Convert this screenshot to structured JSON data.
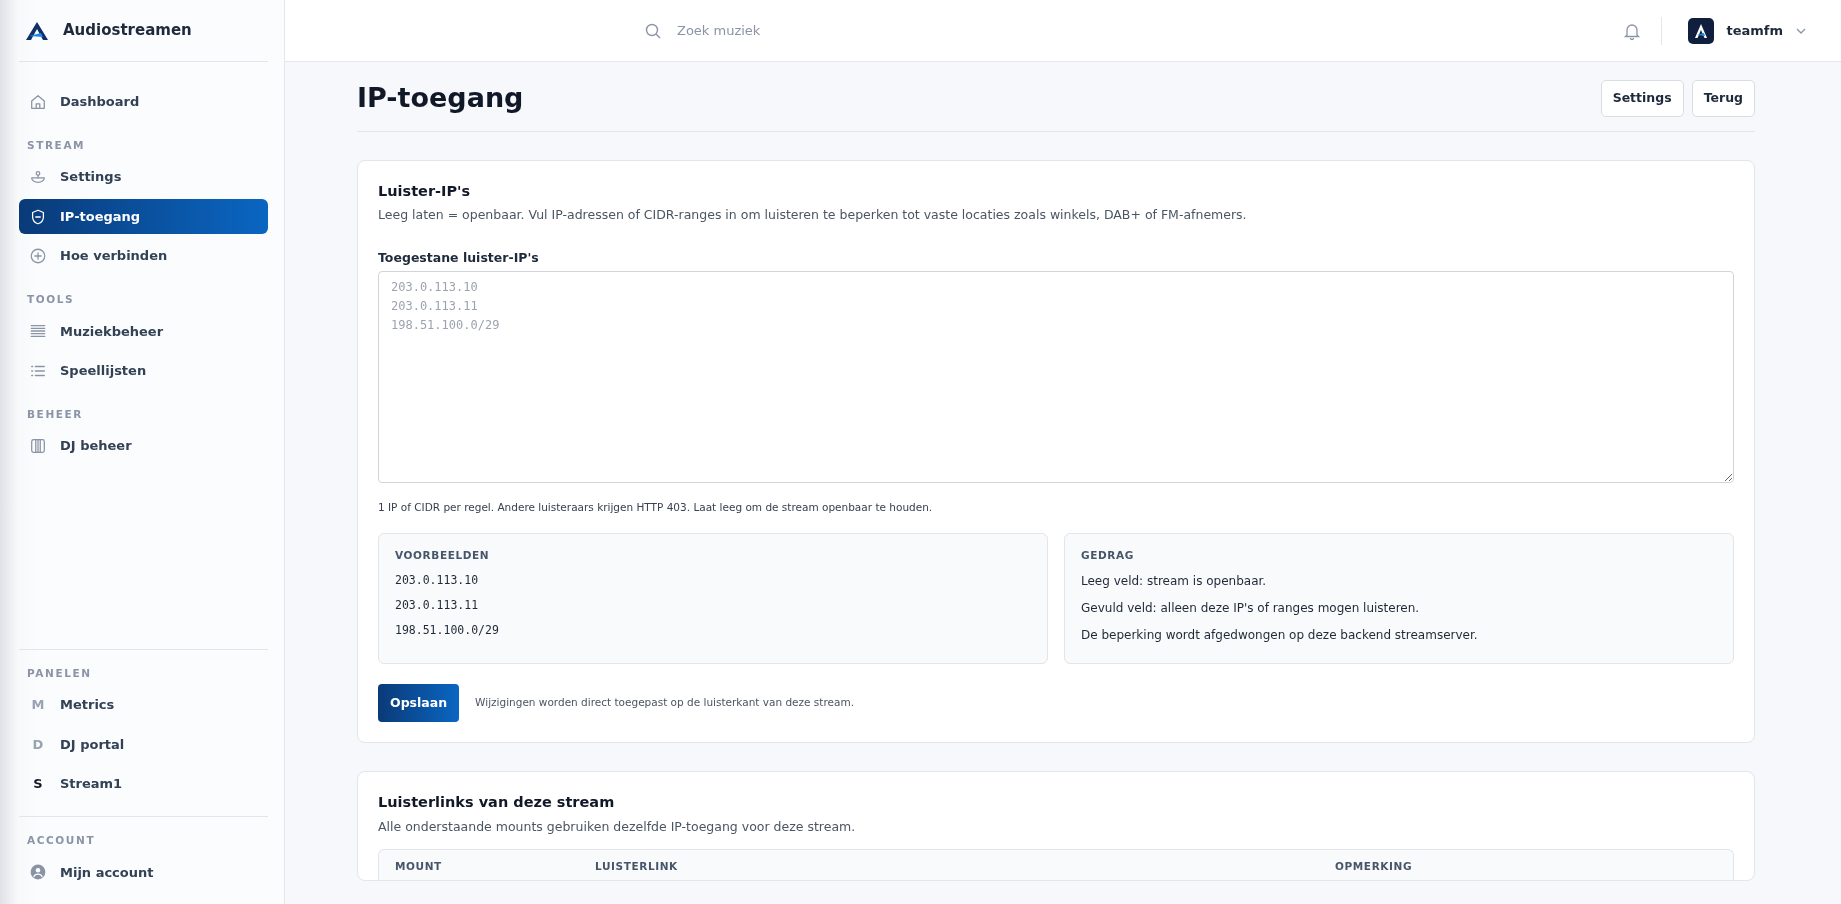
{
  "brand": {
    "name": "Audiostreamen"
  },
  "sidebar": {
    "sections": [
      {
        "items": [
          {
            "label": "Dashboard",
            "kind": "home",
            "selected": false
          }
        ]
      },
      {
        "heading": "STREAM",
        "items": [
          {
            "label": "Settings",
            "kind": "dish",
            "selected": false
          },
          {
            "label": "IP-toegang",
            "kind": "shield",
            "selected": true
          },
          {
            "label": "Hoe verbinden",
            "kind": "plus",
            "selected": false
          }
        ]
      },
      {
        "heading": "TOOLS",
        "items": [
          {
            "label": "Muziekbeheer",
            "kind": "rows",
            "selected": false
          },
          {
            "label": "Speellijsten",
            "kind": "list",
            "selected": false
          }
        ]
      },
      {
        "heading": "BEHEER",
        "items": [
          {
            "label": "DJ beheer",
            "kind": "columns",
            "selected": false
          }
        ]
      }
    ],
    "panels": {
      "heading": "PANELEN",
      "items": [
        {
          "letter": "M",
          "label": "Metrics",
          "highlighted": false
        },
        {
          "letter": "D",
          "label": "DJ portal",
          "highlighted": false
        },
        {
          "letter": "S",
          "label": "Stream1",
          "highlighted": true
        }
      ]
    },
    "account": {
      "heading": "ACCOUNT",
      "items": [
        {
          "label": "Mijn account",
          "kind": "user",
          "selected": false
        }
      ]
    }
  },
  "topbar": {
    "search": {
      "placeholder": "Zoek muziek"
    },
    "user": "teamfm"
  },
  "page": {
    "title": "IP-toegang",
    "buttons": [
      "Settings",
      "Terug"
    ]
  },
  "ip_card": {
    "title": "Luister-IP's",
    "description": "Leeg laten = openbaar. Vul IP-adressen of CIDR-ranges in om luisteren te beperken tot vaste locaties zoals winkels, DAB+ of FM-afnemers.",
    "field": {
      "label": "Toegestane luister-IP's",
      "placeholder": "203.0.113.10\n203.0.113.11\n198.51.100.0/29"
    },
    "help": "1 IP of CIDR per regel. Andere luisteraars krijgen HTTP 403. Laat leeg om de stream openbaar te houden.",
    "panels": [
      {
        "heading": "VOORBEELDEN",
        "kind": "code",
        "lines": [
          "203.0.113.10",
          "203.0.113.11",
          "198.51.100.0/29"
        ]
      },
      {
        "heading": "GEDRAG",
        "kind": "text",
        "lines": [
          "Leeg veld: stream is openbaar.",
          "Gevuld veld: alleen deze IP's of ranges mogen luisteren.",
          "De beperking wordt afgedwongen op deze backend streamserver."
        ]
      }
    ],
    "save_button": "Opslaan",
    "save_note": "Wijzigingen worden direct toegepast op de luisterkant van deze stream."
  },
  "links_card": {
    "title": "Luisterlinks van deze stream",
    "description": "Alle onderstaande mounts gebruiken dezelfde IP-toegang voor deze stream.",
    "table": {
      "columns": [
        "MOUNT",
        "LUISTERLINK",
        "OPMERKING"
      ]
    }
  }
}
